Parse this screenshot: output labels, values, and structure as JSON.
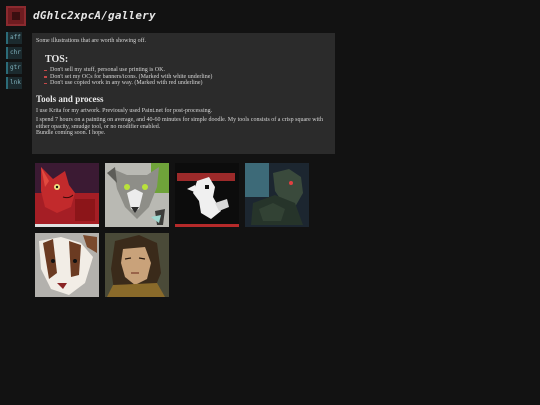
{
  "header": {
    "title": "dGhlc2xpcA/gallery",
    "logo_icon": "square-logo-icon"
  },
  "nav": {
    "items": [
      {
        "label": "aff"
      },
      {
        "label": "chr"
      },
      {
        "label": "gtr"
      },
      {
        "label": "lnk"
      }
    ]
  },
  "intro": {
    "text": "Some illustrations that are worth showing off."
  },
  "tos": {
    "heading": "TOS:",
    "rules": [
      "Don't sell my stuff, personal use printing is OK.",
      "Don't set my OCs for banners/icons. (Marked with white underline)",
      "Don't use copied work in any way. (Marked with red underline)"
    ]
  },
  "process": {
    "heading": "Tools and process",
    "para1": "I use Krita for my artwork. Previously used Paint.net for post-processing.",
    "para2": "I spend 7 hours on a painting on average, and 40-60 minutes for simple doodle. My tools consists of a crisp square with either opacity, smudge tool, or no modifier enabled.",
    "para3": "Bundle coming soon. I hope."
  },
  "gallery": {
    "items": [
      {
        "name": "red-cat-artwork",
        "underline": "#e0e0e0"
      },
      {
        "name": "grey-wolf-artwork",
        "underline": "none"
      },
      {
        "name": "black-white-artwork",
        "underline": "#b52a2a"
      },
      {
        "name": "dark-creature-artwork",
        "underline": "none"
      },
      {
        "name": "badger-artwork",
        "underline": "none"
      },
      {
        "name": "portrait-artwork",
        "underline": "none"
      }
    ]
  },
  "colors": {
    "background": "#121212",
    "panel": "#2b2b2b",
    "accent": "#6e1c20",
    "nav_border": "#2b6b78"
  }
}
